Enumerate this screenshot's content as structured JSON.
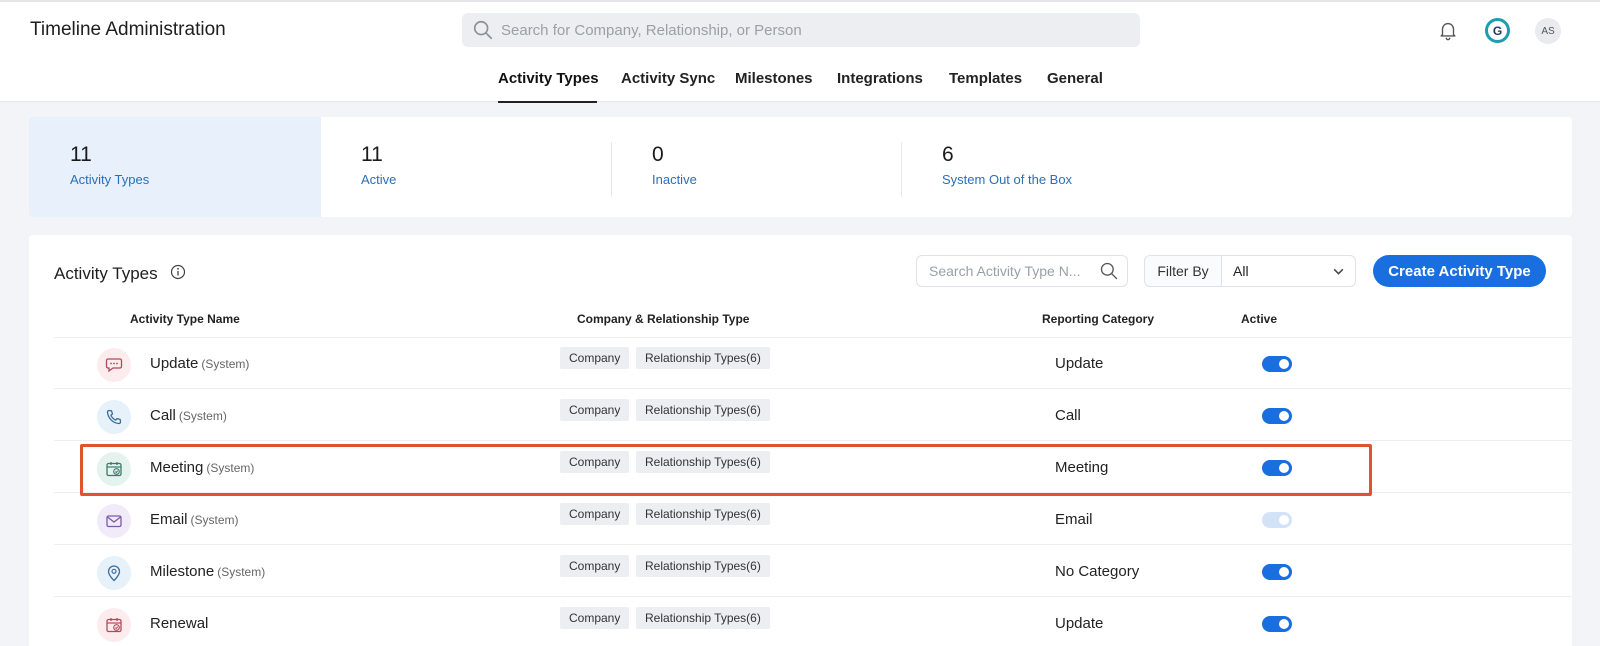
{
  "app": {
    "title": "Timeline Administration"
  },
  "search": {
    "placeholder": "Search for Company, Relationship, or Person"
  },
  "user": {
    "initials": "AS",
    "logo_letter": "G"
  },
  "tabs": [
    {
      "label": "Activity Types",
      "active": true
    },
    {
      "label": "Activity Sync"
    },
    {
      "label": "Milestones"
    },
    {
      "label": "Integrations"
    },
    {
      "label": "Templates"
    },
    {
      "label": "General"
    }
  ],
  "stats": [
    {
      "value": "11",
      "label": "Activity Types",
      "selected": true
    },
    {
      "value": "11",
      "label": "Active"
    },
    {
      "value": "0",
      "label": "Inactive"
    },
    {
      "value": "6",
      "label": "System Out of the Box"
    }
  ],
  "panel": {
    "title": "Activity Types",
    "search_placeholder": "Search Activity Type N...",
    "filter_label": "Filter By",
    "filter_value": "All",
    "create_label": "Create Activity Type"
  },
  "columns": [
    "Activity Type Name",
    "Company & Relationship Type",
    "Reporting Category",
    "Active"
  ],
  "rows": [
    {
      "name": "Update",
      "system": "(System)",
      "chip1": "Company",
      "chip2": "Relationship Types(6)",
      "category": "Update",
      "active": true,
      "icon": "chat-icon"
    },
    {
      "name": "Call",
      "system": "(System)",
      "chip1": "Company",
      "chip2": "Relationship Types(6)",
      "category": "Call",
      "active": true,
      "icon": "phone-icon"
    },
    {
      "name": "Meeting",
      "system": "(System)",
      "chip1": "Company",
      "chip2": "Relationship Types(6)",
      "category": "Meeting",
      "active": true,
      "icon": "calendar-check-icon"
    },
    {
      "name": "Email",
      "system": "(System)",
      "chip1": "Company",
      "chip2": "Relationship Types(6)",
      "category": "Email",
      "active": true,
      "disabled": true,
      "icon": "mail-icon"
    },
    {
      "name": "Milestone",
      "system": "(System)",
      "chip1": "Company",
      "chip2": "Relationship Types(6)",
      "category": "No Category",
      "active": true,
      "icon": "location-pin-icon"
    },
    {
      "name": "Renewal",
      "system": "",
      "chip1": "Company",
      "chip2": "Relationship Types(6)",
      "category": "Update",
      "active": true,
      "icon": "calendar-check-icon"
    }
  ],
  "colors": {
    "accent": "#1a6fe0",
    "highlight": "#e0532d",
    "stat_label": "#2a6fb8"
  }
}
